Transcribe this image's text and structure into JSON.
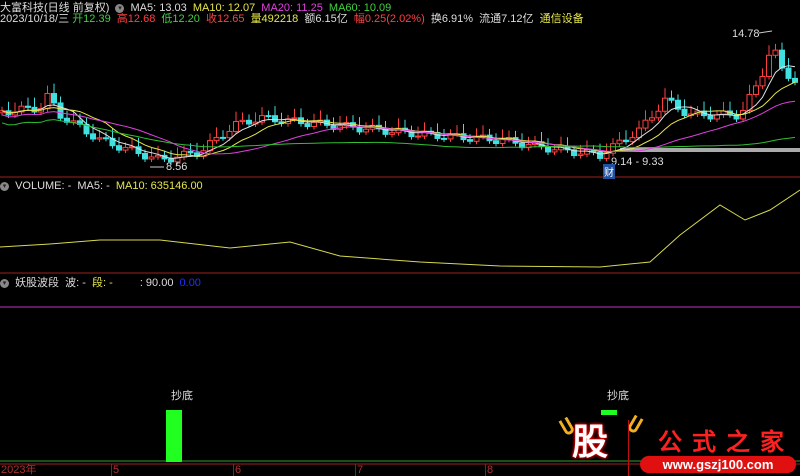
{
  "header": {
    "title": "大富科技(日线 前复权)",
    "ma5": "MA5: 13.03",
    "ma10": "MA10: 12.07",
    "ma20": "MA20: 11.25",
    "ma60": "MA60: 10.09"
  },
  "quote": {
    "date": "2023/10/18/三",
    "open": "开12.39",
    "high": "高12.68",
    "low": "低12.20",
    "close": "收12.65",
    "volume": "量492218",
    "amount": "额6.15亿",
    "change": "幅0.25(2.02%)",
    "turnover": "换6.91%",
    "float": "流通7.12亿",
    "sector": "通信设备"
  },
  "annotations": {
    "high": "14.78",
    "low": "8.56",
    "range": "9.14 - 9.33",
    "finance_marker": "财"
  },
  "volume_panel": {
    "label": "VOLUME: -",
    "ma5": "MA5: -",
    "ma10": "MA10: 635146.00"
  },
  "indicator_panel": {
    "name": "妖股波段",
    "bo": "波: -",
    "duan": "段: -",
    "v1": ": 90.00",
    "v2": "0.00",
    "signal1": "抄底",
    "signal2": "抄底"
  },
  "x_axis": {
    "labels": [
      "2023年",
      "5",
      "6",
      "7",
      "8"
    ]
  },
  "watermark": {
    "logo": "股",
    "text": "公式之家",
    "url": "www.gszj100.com"
  },
  "colors": {
    "up": "#ff4040",
    "down": "#40e0e0",
    "ma5": "#e0e0e0",
    "ma10": "#e6e64c",
    "ma20": "#e040e0",
    "ma60": "#30c030",
    "grid": "#a02020"
  }
}
